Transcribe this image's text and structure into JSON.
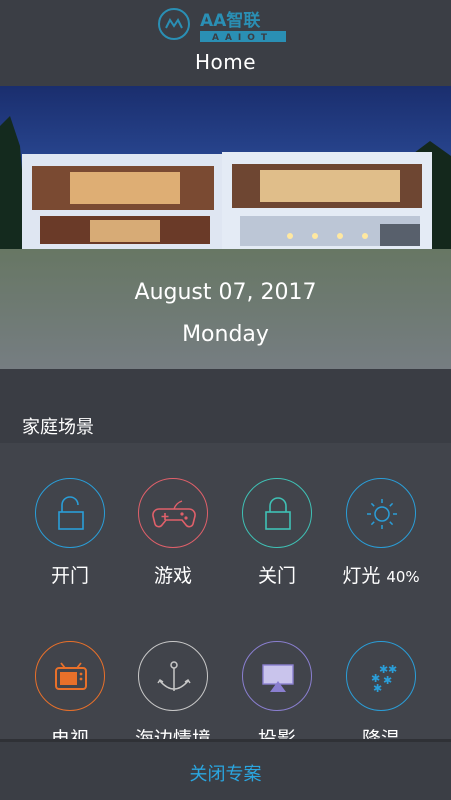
{
  "header": {
    "logo_text": "AA智联",
    "logo_sub": "AAIOT",
    "title": "Home"
  },
  "hero": {
    "date": "August 07, 2017",
    "day": "Monday"
  },
  "section": {
    "title": "家庭场景"
  },
  "scenes": [
    {
      "label": "开门",
      "icon": "unlock-icon",
      "color": "#2a9ed8"
    },
    {
      "label": "游戏",
      "icon": "gamepad-icon",
      "color": "#e0606a"
    },
    {
      "label": "关门",
      "icon": "lock-icon",
      "color": "#3fc1b5"
    },
    {
      "label": "灯光",
      "value": "40%",
      "icon": "sun-icon",
      "color": "#2a9ed8"
    },
    {
      "label": "电视",
      "icon": "tv-icon",
      "color": "#e8702a"
    },
    {
      "label": "海边情境",
      "icon": "anchor-icon",
      "color": "#c8c8c8"
    },
    {
      "label": "投影",
      "icon": "airplay-icon",
      "color": "#8a7fd0"
    },
    {
      "label": "降温",
      "icon": "snowflake-icon",
      "color": "#2a9ed8"
    }
  ],
  "bottom": {
    "label": "关闭专案"
  }
}
